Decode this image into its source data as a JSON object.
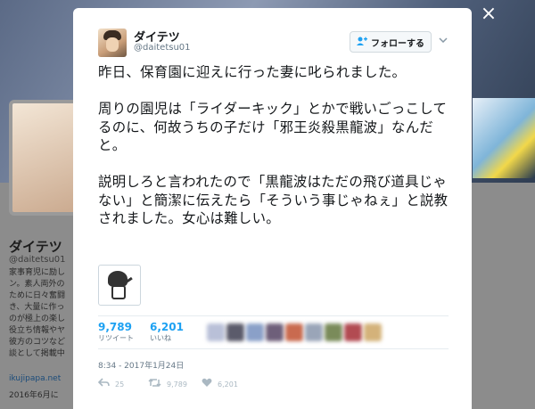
{
  "background": {
    "name": "ダイテツ",
    "handle": "@daitetsu01",
    "bio": "家事育児に励し\nン。素人両外の\nために日々奮闘\nき、大量に作っ\nのが極上の楽し\n役立ち情報やヤ\n彼方のコツなど\n談として掲載中",
    "link": "ikujipapa.net",
    "joined": "2016年6月に"
  },
  "close_icon": "×",
  "tweet": {
    "name": "ダイテツ",
    "handle": "@daitetsu01",
    "follow_label": "フォローする",
    "follow_icon": "person-add-icon",
    "text": "昨日、保育園に迎えに行った妻に叱られました。\n\n周りの園児は「ライダーキック」とかで戦いごっこしてるのに、何故うちの子だけ「邪王炎殺黒龍波」なんだと。\n\n説明しろと言われたので「黒龍波はただの飛び道具じゃない」と簡潔に伝えたら「そういう事じゃねぇ」と説教されました。女心は難しい。",
    "retweets_count": "9,789",
    "retweets_label": "リツイート",
    "likes_count": "6,201",
    "likes_label": "いいね",
    "timestamp": "8:34 - 2017年1月24日",
    "actions": {
      "reply_count": "25",
      "retweet_count": "9,789",
      "like_count": "6,201"
    }
  },
  "colors": {
    "accent": "#1da1f2",
    "muted": "#657786",
    "text": "#14171a"
  }
}
